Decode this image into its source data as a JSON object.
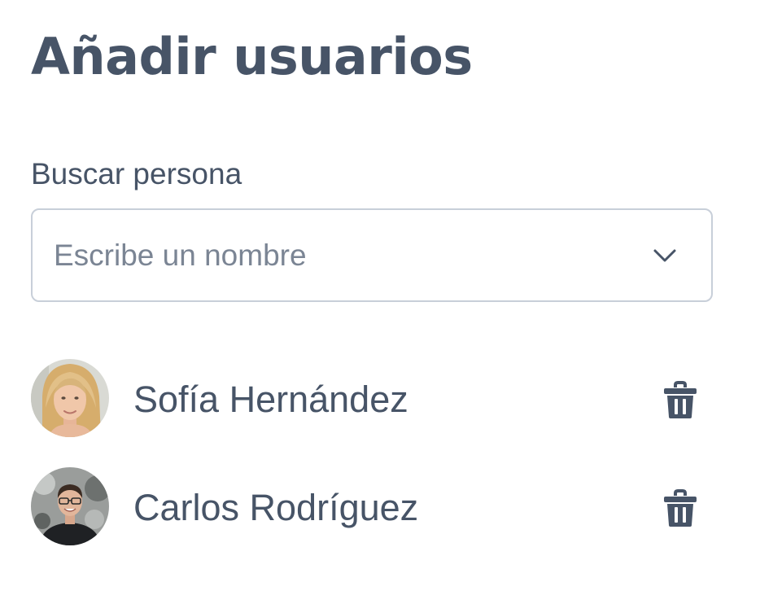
{
  "title": "Añadir usuarios",
  "search": {
    "label": "Buscar persona",
    "placeholder": "Escribe un nombre",
    "value": ""
  },
  "users": [
    {
      "name": "Sofía Hernández",
      "avatar_icon": "avatar-photo-woman",
      "action_icon": "trash-icon"
    },
    {
      "name": "Carlos Rodríguez",
      "avatar_icon": "avatar-photo-man",
      "action_icon": "trash-icon"
    }
  ],
  "colors": {
    "text": "#475467",
    "placeholder": "#7b8594",
    "border": "#c8cfd9",
    "icon": "#475467"
  }
}
